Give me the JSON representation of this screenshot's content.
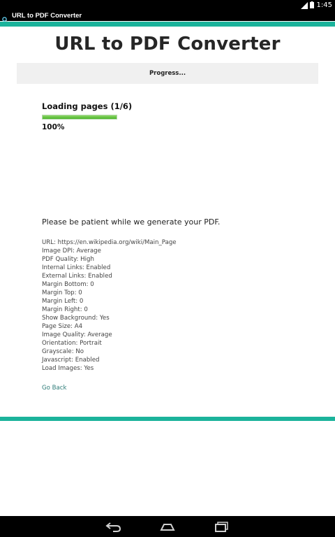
{
  "status_bar": {
    "time": "1:45",
    "icons": [
      "signal-icon",
      "battery-icon"
    ]
  },
  "action_bar": {
    "app_icon": "magnifier-icon",
    "title": "URL to PDF Converter"
  },
  "colors": {
    "accent": "#1bb39b",
    "progress_fill": "#4bb32a",
    "link": "#2e7c78"
  },
  "page": {
    "title": "URL to PDF Converter",
    "progress_header": "Progress...",
    "loading_label": "Loading pages (1/6)",
    "progress_value": 1.0,
    "progress_percent": "100%",
    "patience_message": "Please be patient while we generate your PDF.",
    "settings": [
      "URL: https://en.wikipedia.org/wiki/Main_Page",
      "Image DPI: Average",
      "PDF Quality: High",
      "Internal Links: Enabled",
      "External Links: Enabled",
      "Margin Bottom: 0",
      "Margin Top: 0",
      "Margin Left: 0",
      "Margin Right: 0",
      "Show Background: Yes",
      "Page Size: A4",
      "Image Quality: Average",
      "Orientation: Portrait",
      "Grayscale: No",
      "Javascript: Enabled",
      "Load Images: Yes"
    ],
    "go_back": "Go Back"
  },
  "nav_bar": {
    "buttons": [
      "back-icon",
      "home-icon",
      "recents-icon"
    ]
  }
}
